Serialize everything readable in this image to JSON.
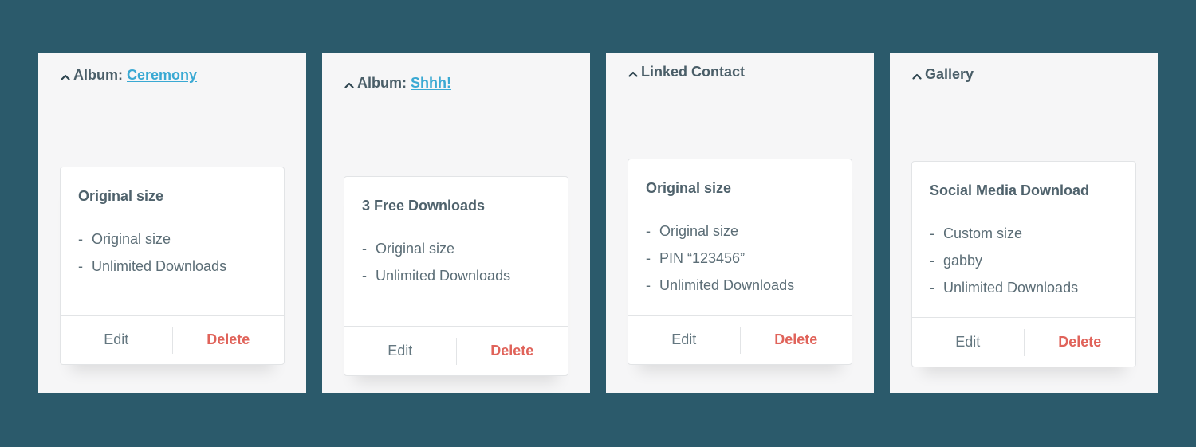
{
  "colors": {
    "background": "#2b5a6b",
    "panel": "#f6f6f7",
    "link": "#3aa9d3",
    "delete": "#e0635a",
    "text": "#4f626c"
  },
  "panels": [
    {
      "header_label": "Album:",
      "header_link": "Ceremony",
      "header_icon": "chevron-up-icon",
      "card": {
        "title": "Original size",
        "items": [
          "Original size",
          "Unlimited Downloads"
        ],
        "edit_label": "Edit",
        "delete_label": "Delete"
      }
    },
    {
      "header_label": "Album:",
      "header_link": "Shhh!",
      "header_icon": "chevron-up-icon",
      "card": {
        "title": "3 Free Downloads",
        "items": [
          "Original size",
          "Unlimited Downloads"
        ],
        "edit_label": "Edit",
        "delete_label": "Delete"
      }
    },
    {
      "header_label": "Linked Contact",
      "header_link": null,
      "header_icon": "chevron-up-icon",
      "card": {
        "title": "Original size",
        "items": [
          "Original size",
          "PIN “123456”",
          "Unlimited Downloads"
        ],
        "edit_label": "Edit",
        "delete_label": "Delete"
      }
    },
    {
      "header_label": "Gallery",
      "header_link": null,
      "header_icon": "chevron-up-icon",
      "card": {
        "title": "Social Media Download",
        "items": [
          "Custom size",
          "gabby",
          "Unlimited Downloads"
        ],
        "edit_label": "Edit",
        "delete_label": "Delete"
      }
    }
  ],
  "list_bullet": "-"
}
